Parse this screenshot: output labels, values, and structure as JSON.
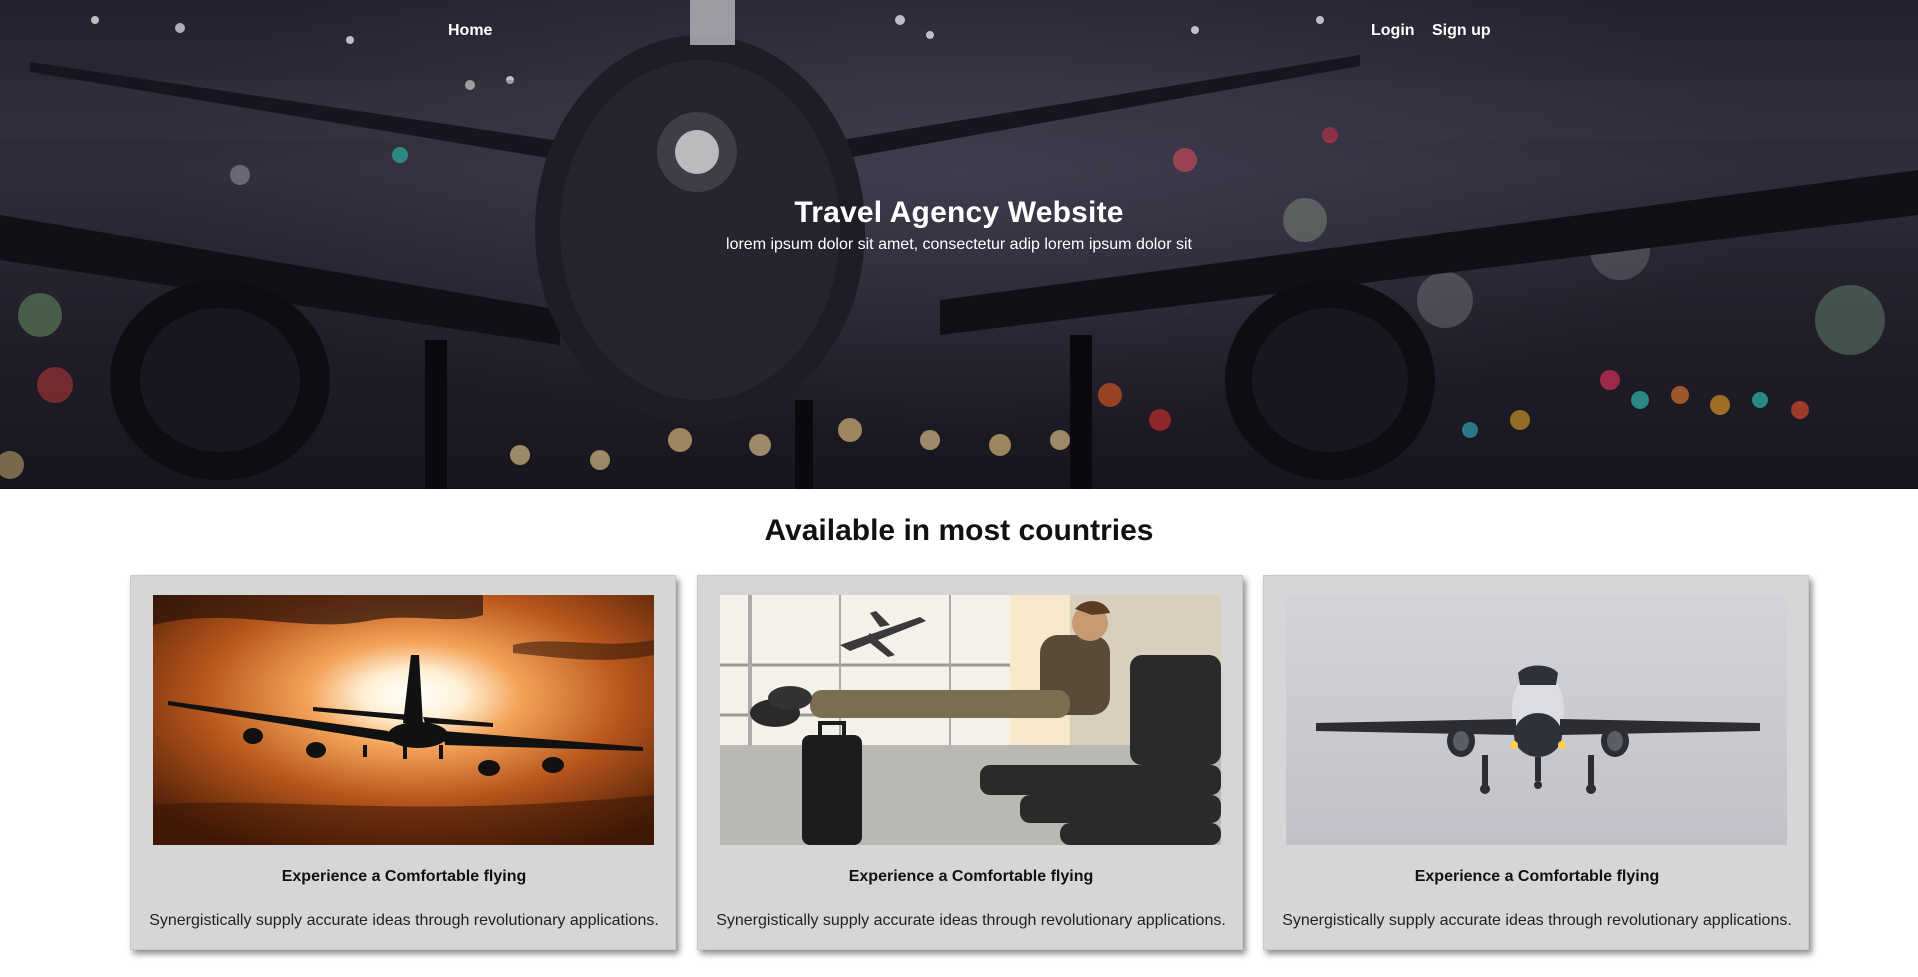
{
  "nav": {
    "home": "Home",
    "login": "Login",
    "signup": "Sign up"
  },
  "hero": {
    "title": "Travel Agency Website",
    "subtitle": "lorem ipsum dolor sit amet, consectetur adip lorem ipsum dolor sit"
  },
  "section": {
    "title": "Available in most countries"
  },
  "cards": [
    {
      "image": "airplane-sunset-silhouette",
      "title": "Experience a Comfortable flying",
      "text": "Synergistically supply accurate ideas through revolutionary applications."
    },
    {
      "image": "traveler-waiting-at-airport",
      "title": "Experience a Comfortable flying",
      "text": "Synergistically supply accurate ideas through revolutionary applications."
    },
    {
      "image": "airplane-landing-front-view",
      "title": "Experience a Comfortable flying",
      "text": "Synergistically supply accurate ideas through revolutionary applications."
    }
  ],
  "colors": {
    "card_background": "#d6d6d6",
    "hero_overlay": "#2c2b3a",
    "text_light": "#ffffff"
  }
}
